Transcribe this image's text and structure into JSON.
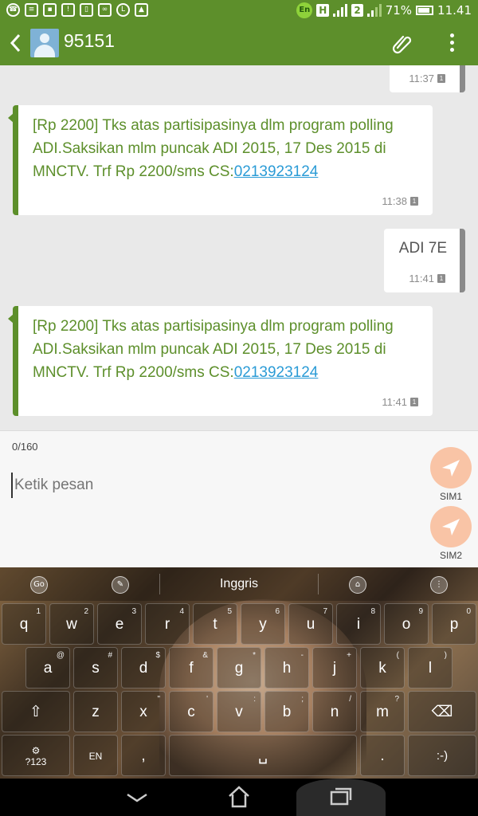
{
  "status_bar": {
    "language_badge": "En",
    "sim_indicator": "2",
    "battery": "71%",
    "time": "11.41"
  },
  "header": {
    "contact": "95151"
  },
  "messages": [
    {
      "direction": "out",
      "text": "",
      "time": "11:37"
    },
    {
      "direction": "in",
      "text": "[Rp 2200] Tks atas partisipasinya dlm program polling ADI.Saksikan mlm puncak ADI 2015, 17 Des 2015 di MNCTV. Trf Rp 2200/sms CS:",
      "link": "0213923124",
      "time": "11:38"
    },
    {
      "direction": "out",
      "text": "ADI 7E",
      "time": "11:41"
    },
    {
      "direction": "in",
      "text": "[Rp 2200] Tks atas partisipasinya dlm program polling ADI.Saksikan mlm puncak ADI 2015, 17 Des 2015 di MNCTV. Trf Rp 2200/sms CS:",
      "link": "0213923124",
      "time": "11:41"
    }
  ],
  "compose": {
    "counter": "0/160",
    "placeholder": "Ketik pesan",
    "sim1_label": "SIM1",
    "sim2_label": "SIM2"
  },
  "keyboard": {
    "language": "Inggris",
    "row1": [
      [
        "q",
        "1"
      ],
      [
        "w",
        "2"
      ],
      [
        "e",
        "3"
      ],
      [
        "r",
        "4"
      ],
      [
        "t",
        "5"
      ],
      [
        "y",
        "6"
      ],
      [
        "u",
        "7"
      ],
      [
        "i",
        "8"
      ],
      [
        "o",
        "9"
      ],
      [
        "p",
        "0"
      ]
    ],
    "row2": [
      [
        "a",
        "@"
      ],
      [
        "s",
        "#"
      ],
      [
        "d",
        "$"
      ],
      [
        "f",
        "&"
      ],
      [
        "g",
        "*"
      ],
      [
        "h",
        "-"
      ],
      [
        "j",
        "+"
      ],
      [
        "k",
        "("
      ],
      [
        "l",
        ")"
      ]
    ],
    "row3": [
      [
        "z",
        ""
      ],
      [
        "x",
        "\""
      ],
      [
        "c",
        "'"
      ],
      [
        "v",
        ":"
      ],
      [
        "b",
        ";"
      ],
      [
        "n",
        "/"
      ],
      [
        "m",
        "?"
      ]
    ],
    "symbols_label": "?123",
    "en_label": "EN",
    "comma": ",",
    "period": ".",
    "emoji": ":-)"
  }
}
